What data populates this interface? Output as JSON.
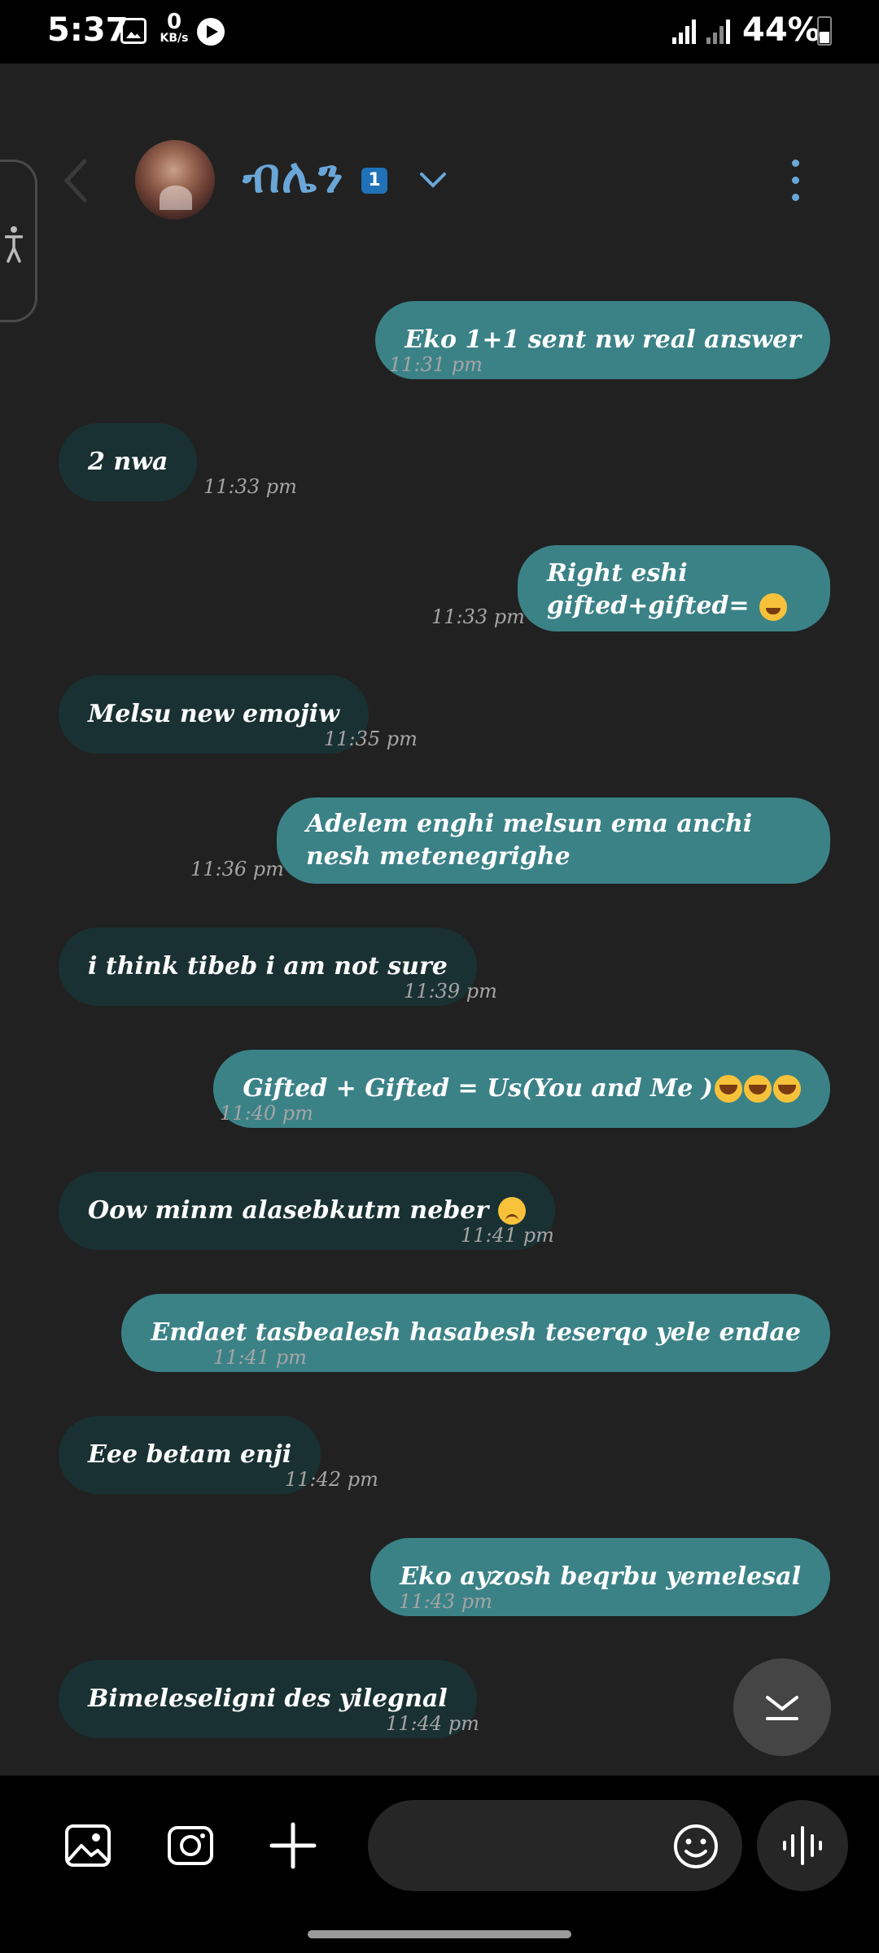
{
  "status_bar": {
    "time": "5:37",
    "net_speed_value": "0",
    "net_speed_unit": "KB/s",
    "battery_percent": "44%"
  },
  "header": {
    "contact_name": "ብሌን",
    "unread_badge": "1"
  },
  "messages": [
    {
      "side": "sent",
      "text": "Eko 1+1 sent nw real answer",
      "time": "11:31 pm"
    },
    {
      "side": "received",
      "text": "2 nwa",
      "time": "11:33 pm"
    },
    {
      "side": "sent",
      "text": "Right eshi gifted+gifted=",
      "time": "11:33 pm",
      "emoji": "smiling-face-with-hearts"
    },
    {
      "side": "received",
      "text": "Melsu new emojiw",
      "time": "11:35 pm"
    },
    {
      "side": "sent",
      "text": "Adelem enghi melsun ema anchi nesh metenegrighe",
      "time": "11:36 pm"
    },
    {
      "side": "received",
      "text": "i think tibeb i am not sure",
      "time": "11:39 pm"
    },
    {
      "side": "sent",
      "text": "Gifted + Gifted = Us(You and Me )",
      "time": "11:40 pm",
      "emoji": "grinning-sweat x3"
    },
    {
      "side": "received",
      "text": "Oow minm alasebkutm neber",
      "time": "11:41 pm",
      "emoji": "sad-face"
    },
    {
      "side": "sent",
      "text": "Endaet tasbealesh hasabesh teserqo yele endae",
      "time": "11:41 pm"
    },
    {
      "side": "received",
      "text": "Eee betam enji",
      "time": "11:42 pm"
    },
    {
      "side": "sent",
      "text": "Eko ayzosh beqrbu yemelesal",
      "time": "11:43 pm"
    },
    {
      "side": "received",
      "text": "Bimeleseligni des yilegnal",
      "time": "11:44 pm"
    }
  ],
  "composer": {
    "placeholder": ""
  },
  "colors": {
    "sent_bubble": "#3b8287",
    "received_bubble": "#1a3133",
    "accent": "#6aa7d8",
    "background": "#212121"
  },
  "icons": [
    "gallery-icon",
    "camera-icon",
    "plus-icon",
    "emoji-icon",
    "voice-icon",
    "scroll-down-icon",
    "more-icon",
    "back-icon",
    "accessibility-icon"
  ]
}
